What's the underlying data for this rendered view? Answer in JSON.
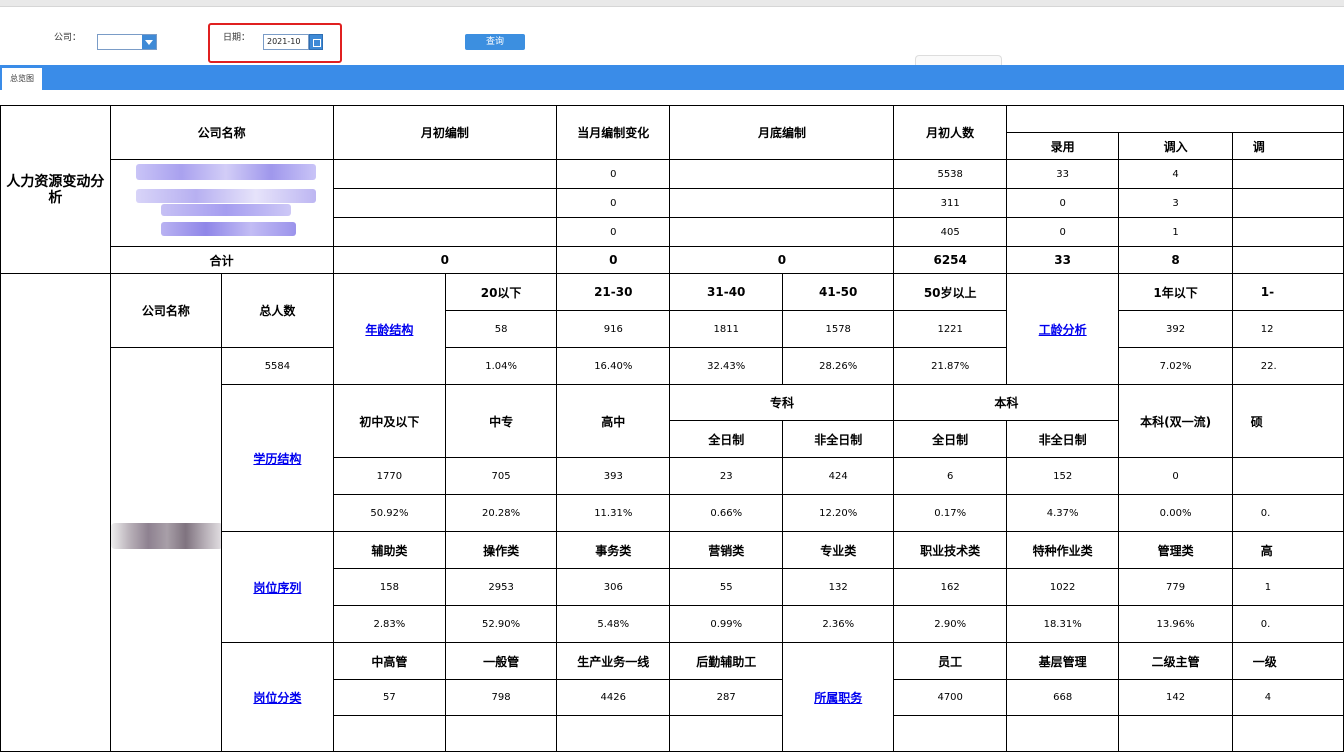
{
  "toolbar": {
    "company_label": "公司：",
    "date_label": "日期：",
    "date_value": "2021-10",
    "query_button": "查询"
  },
  "tabs": [
    "总览图"
  ],
  "section1": {
    "title": "人力资源变动分析",
    "headers": {
      "company_name": "公司名称",
      "month_start_quota": "月初编制",
      "month_quota_change": "当月编制变化",
      "month_end_quota": "月底编制",
      "month_start_headcount": "月初人数",
      "hired": "录用",
      "transfer_in": "调入",
      "transfer_out_partial": "调"
    },
    "rows": [
      {
        "quota_change": "0",
        "headcount": "5538",
        "hired": "33",
        "transfer_in": "4"
      },
      {
        "quota_change": "0",
        "headcount": "311",
        "hired": "0",
        "transfer_in": "3"
      },
      {
        "quota_change": "0",
        "headcount": "405",
        "hired": "0",
        "transfer_in": "1"
      }
    ],
    "total": {
      "label": "合计",
      "start_quota": "0",
      "quota_change": "0",
      "end_quota": "0",
      "headcount": "6254",
      "hired": "33",
      "transfer_in": "8"
    }
  },
  "section2": {
    "company_name": "公司名称",
    "total_people": "总人数",
    "total_value": "5584",
    "age": {
      "link": "年龄结构",
      "headers": [
        "20以下",
        "21-30",
        "31-40",
        "41-50",
        "50岁以上"
      ],
      "counts": [
        "58",
        "916",
        "1811",
        "1578",
        "1221"
      ],
      "percents": [
        "1.04%",
        "16.40%",
        "32.43%",
        "28.26%",
        "21.87%"
      ]
    },
    "seniority": {
      "link": "工龄分析",
      "headers": [
        "1年以下",
        "1-"
      ],
      "counts": [
        "392",
        "12"
      ],
      "percents": [
        "7.02%",
        "22."
      ]
    },
    "education": {
      "link": "学历结构",
      "headers": [
        "初中及以下",
        "中专",
        "高中"
      ],
      "group_zhuanke": "专科",
      "group_benke": "本科",
      "sub_headers": [
        "全日制",
        "非全日制",
        "全日制",
        "非全日制"
      ],
      "benke_double": "本科(双一流)",
      "partial_header": "硕",
      "counts": [
        "1770",
        "705",
        "393",
        "23",
        "424",
        "6",
        "152",
        "0"
      ],
      "percents": [
        "50.92%",
        "20.28%",
        "11.31%",
        "0.66%",
        "12.20%",
        "0.17%",
        "4.37%",
        "0.00%"
      ],
      "partial_percent": "0."
    },
    "position_sequence": {
      "link": "岗位序列",
      "headers": [
        "辅助类",
        "操作类",
        "事务类",
        "营销类",
        "专业类",
        "职业技术类",
        "特种作业类",
        "管理类",
        "高"
      ],
      "counts": [
        "158",
        "2953",
        "306",
        "55",
        "132",
        "162",
        "1022",
        "779",
        "1"
      ],
      "percents": [
        "2.83%",
        "52.90%",
        "5.48%",
        "0.99%",
        "2.36%",
        "2.90%",
        "18.31%",
        "13.96%",
        "0."
      ]
    },
    "position_category": {
      "link": "岗位分类",
      "headers": [
        "中高管",
        "一般管",
        "生产业务一线",
        "后勤辅助工"
      ],
      "counts": [
        "57",
        "798",
        "4426",
        "287"
      ]
    },
    "rank": {
      "link": "所属职务",
      "headers": [
        "员工",
        "基层管理",
        "二级主管",
        "一级"
      ],
      "counts": [
        "4700",
        "668",
        "142",
        "4"
      ]
    }
  },
  "colors": {
    "tabbar": "#3a8ce8",
    "button": "#3c8fe0",
    "highlight": "#e02020",
    "link": "#0000ee"
  }
}
